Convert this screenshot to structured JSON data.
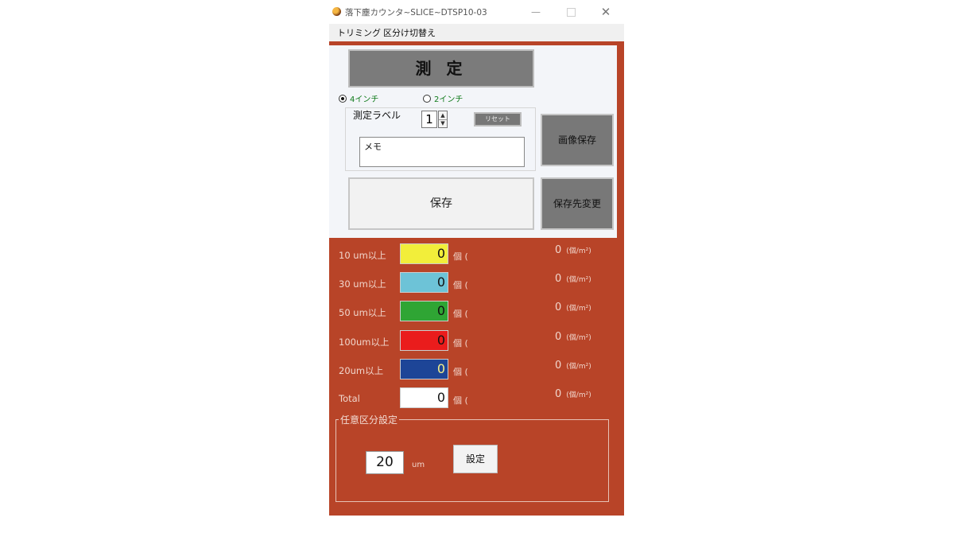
{
  "window": {
    "title": "落下塵カウンタ~SLICE~DTSP10-03",
    "minimize_glyph": "—",
    "maximize_glyph": "",
    "close_glyph": "✕",
    "icon": "app-ball-icon"
  },
  "menu": {
    "items": [
      "トリミング",
      "区分け切替え"
    ]
  },
  "panel": {
    "measure_label": "測 定",
    "radio_4": "4インチ",
    "radio_2": "2インチ",
    "radio_selected": "4インチ",
    "label_title": "測定ラベル",
    "label_value": "1",
    "spin_up": "▲",
    "spin_down": "▼",
    "reset_label": "リセット",
    "memo_text": "メモ",
    "save_label": "保存",
    "image_save_label": "画像保存",
    "dest_change_label": "保存先変更"
  },
  "rows": [
    {
      "label": "10 um以上",
      "count": "0",
      "unit": "個 (",
      "density": "0",
      "density_unit": "(個/m²)",
      "color": "#f2ee3a",
      "text_color": "#111111"
    },
    {
      "label": "30 um以上",
      "count": "0",
      "unit": "個 (",
      "density": "0",
      "density_unit": "(個/m²)",
      "color": "#6dc3d7",
      "text_color": "#111111"
    },
    {
      "label": "50 um以上",
      "count": "0",
      "unit": "個 (",
      "density": "0",
      "density_unit": "(個/m²)",
      "color": "#2fa534",
      "text_color": "#111111"
    },
    {
      "label": "100um以上",
      "count": "0",
      "unit": "個 (",
      "density": "0",
      "density_unit": "(個/m²)",
      "color": "#ea1c1c",
      "text_color": "#111111"
    },
    {
      "label": "20um以上",
      "count": "0",
      "unit": "個 (",
      "density": "0",
      "density_unit": "(個/m²)",
      "color": "#1d4597",
      "text_color": "#f5f08a"
    },
    {
      "label": "Total",
      "count": "0",
      "unit": "個 (",
      "density": "0",
      "density_unit": "(個/m²)",
      "color": "#ffffff",
      "text_color": "#111111"
    }
  ],
  "custom": {
    "title": "任意区分設定",
    "value": "20",
    "unit": "um",
    "set_label": "設定"
  }
}
